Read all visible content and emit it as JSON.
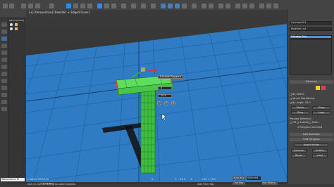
{
  "app": {
    "colors": {
      "viewport_bg": "#2f7bc4",
      "grid": "#1a4f86",
      "object_green": "#4bd44b",
      "selected_face": "#e05040",
      "ui_bg": "#444444"
    }
  },
  "viewport": {
    "label": "[+] [Perspective] [Realistic + Edged Faces]"
  },
  "scene_explorer": {
    "items": [
      "Name (Sorted"
    ]
  },
  "caddy": {
    "title": "Extrude Polygons",
    "value1": "0",
    "value2": "20.0",
    "ok_icon": "check-icon",
    "apply_icon": "plus-icon",
    "cancel_icon": "x-icon"
  },
  "command_panel": {
    "object_name": "Cylinder001",
    "modifier_list": "Modifier List",
    "stack_item": "Editable Poly",
    "selection_title": "Selection",
    "by_vertex": "By Vertex",
    "ignore_backfacing": "Ignore Backfacing",
    "by_angle": "By Angle:",
    "by_angle_value": "45.0",
    "shrink": "Shrink",
    "grow": "Grow",
    "ring": "Ring",
    "loop": "Loop",
    "preview_selection": "Preview Selection",
    "off": "Off",
    "subobj": "SubObj",
    "multi": "Multi",
    "selected_status": "4 Polygons Selected",
    "soft_selection": "Soft Selection",
    "edit_polygons": "Edit Polygons",
    "insert_vertex": "Insert Vertex",
    "extrude": "Extrude",
    "outline": "Outline",
    "bevel": "Bevel",
    "inset": "Inset"
  },
  "timeline": {
    "frame": "0 / 100"
  },
  "status": {
    "objects": "1 Object Selected",
    "hint": "Click or click-and-drag to select objects",
    "x_label": "X:",
    "y_label": "Y:",
    "y_value": "-16.0",
    "z_label": "Z:",
    "grid": "Grid = 10.0",
    "auto_key": "Auto Key",
    "selected": "Selected",
    "set_key": "Set Key",
    "key_filters": "Key Filters...",
    "add_time_tag": "Add Time Tag",
    "welcome": "Welcome to M"
  }
}
